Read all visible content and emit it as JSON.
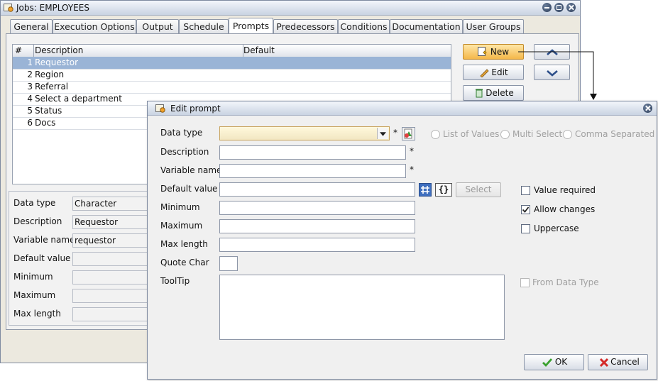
{
  "main_window": {
    "title": "Jobs: EMPLOYEES",
    "tabs": [
      {
        "label": "General"
      },
      {
        "label": "Execution Options"
      },
      {
        "label": "Output"
      },
      {
        "label": "Schedule"
      },
      {
        "label": "Prompts"
      },
      {
        "label": "Predecessors"
      },
      {
        "label": "Conditions"
      },
      {
        "label": "Documentation"
      },
      {
        "label": "User Groups"
      }
    ],
    "active_tab": "Prompts",
    "grid": {
      "columns": [
        "#",
        "Description",
        "Default"
      ],
      "rows": [
        {
          "num": "1",
          "description": "Requestor",
          "default": ""
        },
        {
          "num": "2",
          "description": "Region",
          "default": ""
        },
        {
          "num": "3",
          "description": "Referral",
          "default": ""
        },
        {
          "num": "4",
          "description": "Select a department",
          "default": ""
        },
        {
          "num": "5",
          "description": "Status",
          "default": ""
        },
        {
          "num": "6",
          "description": "Docs",
          "default": ""
        }
      ],
      "selected_row": 1
    },
    "buttons": {
      "new": "New",
      "edit": "Edit",
      "delete": "Delete"
    },
    "details": {
      "data_type_label": "Data type",
      "data_type_value": "Character",
      "description_label": "Description",
      "description_value": "Requestor",
      "variable_name_label": "Variable name",
      "variable_name_value": "requestor",
      "default_value_label": "Default value",
      "minimum_label": "Minimum",
      "maximum_label": "Maximum",
      "max_length_label": "Max length"
    }
  },
  "dialog": {
    "title": "Edit prompt",
    "data_type_label": "Data type",
    "description_label": "Description",
    "variable_name_label": "Variable name",
    "default_value_label": "Default value",
    "minimum_label": "Minimum",
    "maximum_label": "Maximum",
    "max_length_label": "Max length",
    "quote_char_label": "Quote Char",
    "tooltip_label": "ToolTip",
    "required_marker": "*",
    "variables_button": "{}",
    "select_button": "Select",
    "options": {
      "list_of_values": "List of Values",
      "multi_select": "Multi Select",
      "comma_separated": "Comma Separated"
    },
    "value_required": {
      "label": "Value required",
      "checked": false
    },
    "allow_changes": {
      "label": "Allow changes",
      "checked": true
    },
    "uppercase": {
      "label": "Uppercase",
      "checked": false
    },
    "from_data_type": {
      "label": "From Data Type",
      "checked": false
    },
    "ok_label": "OK",
    "cancel_label": "Cancel"
  },
  "colors": {
    "accent": "#f4b74a",
    "selection": "#9ab4d6",
    "titlebar": "#c9d3e2"
  }
}
